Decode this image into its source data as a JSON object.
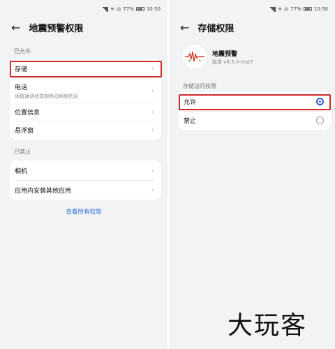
{
  "status_bar": {
    "battery": "77%",
    "time": "10:50"
  },
  "left": {
    "title": "地震预警权限",
    "allowed_header": "已允许",
    "allowed_items": [
      {
        "label": "存储",
        "sub": ""
      },
      {
        "label": "电话",
        "sub": "读取通话状态和移动网络信息"
      },
      {
        "label": "位置信息",
        "sub": ""
      },
      {
        "label": "悬浮窗",
        "sub": ""
      }
    ],
    "denied_header": "已禁止",
    "denied_items": [
      {
        "label": "相机"
      },
      {
        "label": "应用内安装其他应用"
      }
    ],
    "view_all": "查看所有权限"
  },
  "right": {
    "title": "存储权限",
    "app_name": "地震预警",
    "app_version": "版本 v8.3.0-test7",
    "section_header": "存储访问权限",
    "options": [
      {
        "label": "允许",
        "selected": true
      },
      {
        "label": "禁止",
        "selected": false
      }
    ]
  },
  "watermark": "大玩客",
  "colors": {
    "accent": "#2f5fd6",
    "highlight": "#d0282d"
  }
}
